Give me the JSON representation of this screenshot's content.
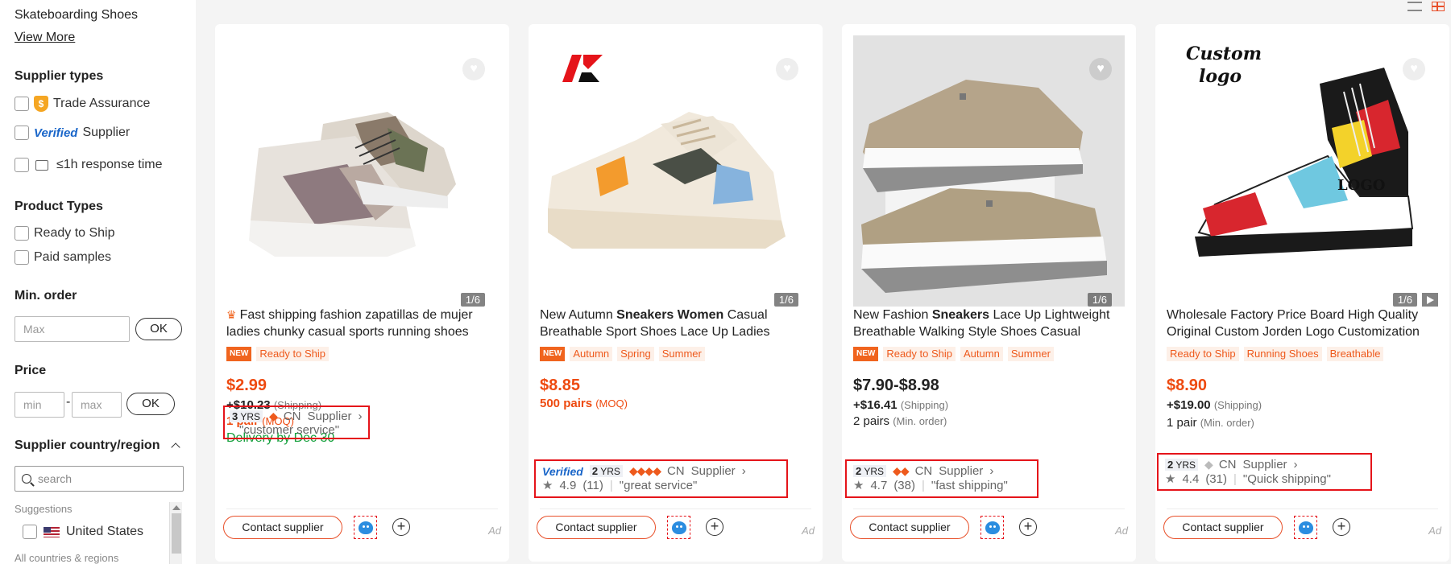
{
  "sidebar": {
    "category_item": "Skateboarding Shoes",
    "view_more": "View More",
    "supplier_types": {
      "heading": "Supplier types",
      "trade_assurance": "Trade Assurance",
      "verified_logo": "Verified",
      "verified_label": "Supplier",
      "response_time": "≤1h response time"
    },
    "product_types": {
      "heading": "Product Types",
      "ready_to_ship": "Ready to Ship",
      "paid_samples": "Paid samples"
    },
    "min_order": {
      "heading": "Min. order",
      "placeholder": "Max",
      "ok": "OK"
    },
    "price": {
      "heading": "Price",
      "min_placeholder": "min",
      "separator": "-",
      "max_placeholder": "max",
      "ok": "OK"
    },
    "country": {
      "heading": "Supplier country/region",
      "search_placeholder": "search",
      "suggestions_label": "Suggestions",
      "united_states": "United States",
      "all_countries": "All countries & regions"
    }
  },
  "products": [
    {
      "counter": "1/6",
      "title_parts": [
        "Fast shipping fashion zapatillas de mujer ladies chunky casual sports running shoes"
      ],
      "new_badge": "NEW",
      "tags": [
        "Ready to Ship"
      ],
      "price": "$2.99",
      "shipping": "+$10.23",
      "shipping_label": "(Shipping)",
      "moq": "1 pair",
      "moq_label": "(MOQ)",
      "delivery": "Delivery by Dec 30",
      "years": "3",
      "yrs_label": "YRS",
      "country": "CN",
      "supplier_label": "Supplier",
      "review": "\"customer service\"",
      "contact": "Contact supplier",
      "ad": "Ad"
    },
    {
      "counter": "1/6",
      "title_a": "New Autumn ",
      "title_b": "Sneakers Women",
      "title_c": " Casual Breathable Sport Shoes Lace Up Ladies",
      "new_badge": "NEW",
      "tags": [
        "Autumn",
        "Spring",
        "Summer"
      ],
      "price": "$8.85",
      "moq": "500 pairs",
      "moq_label": "(MOQ)",
      "verified": "Verified",
      "years": "2",
      "yrs_label": "YRS",
      "country": "CN",
      "supplier_label": "Supplier",
      "rating": "4.9",
      "rating_count": "(11)",
      "review": "\"great service\"",
      "contact": "Contact supplier",
      "ad": "Ad"
    },
    {
      "counter": "1/6",
      "title_a": "New Fashion ",
      "title_b": "Sneakers",
      "title_c": " Lace Up Lightweight Breathable Walking Style Shoes Casual",
      "new_badge": "NEW",
      "tags": [
        "Ready to Ship",
        "Autumn",
        "Summer"
      ],
      "price": "$7.90-$8.98",
      "shipping": "+$16.41",
      "shipping_label": "(Shipping)",
      "moq": "2 pairs",
      "moq_label": "(Min. order)",
      "years": "2",
      "yrs_label": "YRS",
      "country": "CN",
      "supplier_label": "Supplier",
      "rating": "4.7",
      "rating_count": "(38)",
      "review": "\"fast shipping\"",
      "contact": "Contact supplier",
      "ad": "Ad"
    },
    {
      "counter": "1/6",
      "image_text_1": "Custom",
      "image_text_2": "logo",
      "image_text_3": "LOGO",
      "title": "Wholesale Factory Price Board High Quality Original Custom Jorden Logo Customization",
      "tags": [
        "Ready to Ship",
        "Running Shoes",
        "Breathable"
      ],
      "price": "$8.90",
      "shipping": "+$19.00",
      "shipping_label": "(Shipping)",
      "moq": "1 pair",
      "moq_label": "(Min. order)",
      "years": "2",
      "yrs_label": "YRS",
      "country": "CN",
      "supplier_label": "Supplier",
      "rating": "4.4",
      "rating_count": "(31)",
      "review": "\"Quick shipping\"",
      "contact": "Contact supplier",
      "ad": "Ad"
    }
  ],
  "colors": {
    "accent_orange": "#ee4a10",
    "highlight_red": "#e5141a",
    "delivery_green": "#13a03c",
    "verified_blue": "#1a66c9"
  }
}
